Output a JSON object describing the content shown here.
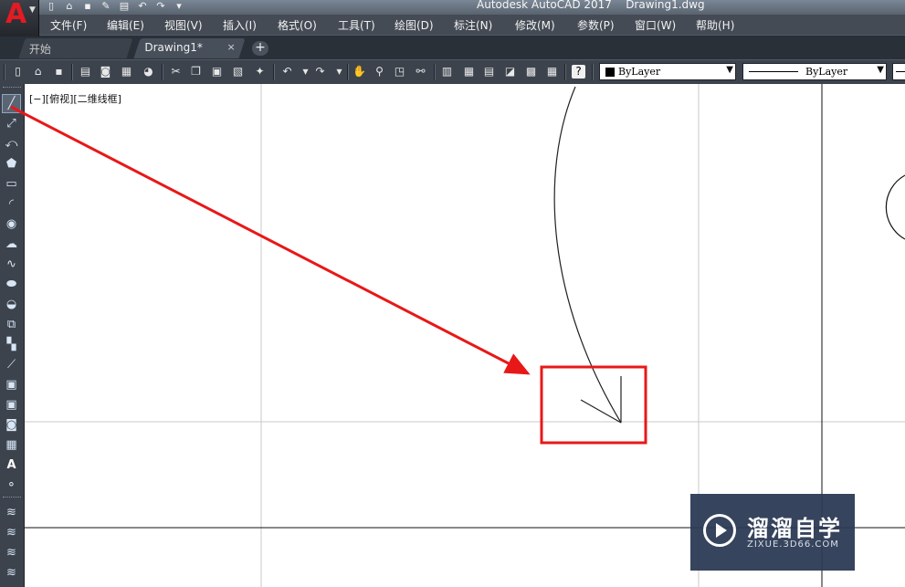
{
  "window": {
    "app_title": "Autodesk AutoCAD 2017",
    "document_title": "Drawing1.dwg",
    "logo_letter": "A"
  },
  "menu": [
    "文件(F)",
    "编辑(E)",
    "视图(V)",
    "插入(I)",
    "格式(O)",
    "工具(T)",
    "绘图(D)",
    "标注(N)",
    "修改(M)",
    "参数(P)",
    "窗口(W)",
    "帮助(H)"
  ],
  "tabs": {
    "start": "开始",
    "drawing": "Drawing1*",
    "close_glyph": "×",
    "new_glyph": "+"
  },
  "toolbar": {
    "color_value": "ByLayer",
    "linetype_value": "ByLayer"
  },
  "viewport": {
    "label": "[−][俯视][二维线框]"
  },
  "annotation": {
    "arrow_color": "#e81818",
    "box_color": "#e81818"
  },
  "watermark": {
    "title": "溜溜自学",
    "url": "ZIXUE.3D66.COM"
  }
}
